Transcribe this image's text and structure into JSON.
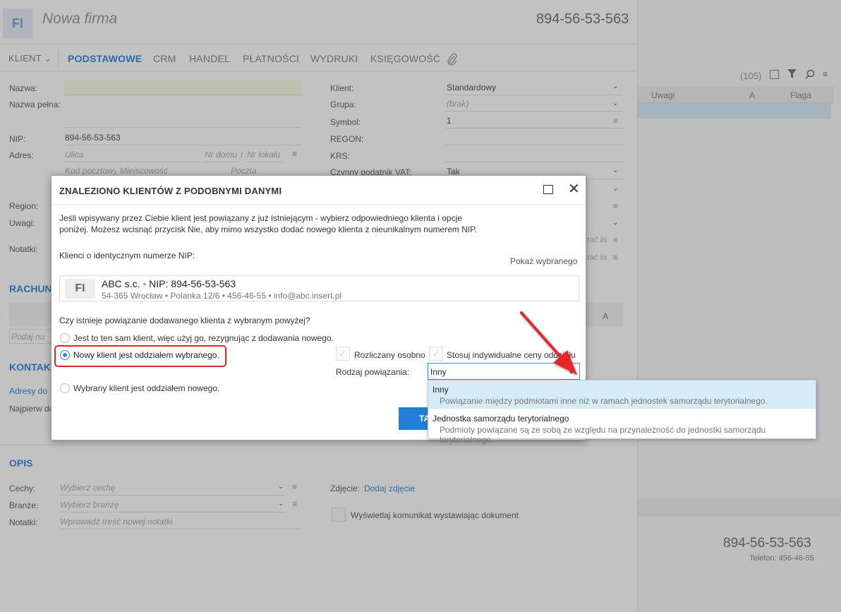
{
  "header": {
    "avatar": "FI",
    "title": "Nowa firma",
    "nip": "894-56-53-563"
  },
  "tabs": [
    {
      "label": "KLIENT",
      "active": false
    },
    {
      "label": "PODSTAWOWE",
      "active": true
    },
    {
      "label": "CRM",
      "active": false
    },
    {
      "label": "HANDEL",
      "active": false
    },
    {
      "label": "PŁATNOŚCI",
      "active": false
    },
    {
      "label": "WYDRUKI",
      "active": false
    },
    {
      "label": "KSIĘGOWOŚĆ",
      "active": false
    }
  ],
  "form_left": {
    "nazwa_label": "Nazwa:",
    "nazwa_pelna_label": "Nazwa pełna:",
    "nip_label": "NIP:",
    "nip_value": "894-56-53-563",
    "adres_label": "Adres:",
    "ulica_ph": "Ulica",
    "nr_domu_ph": "Nr domu",
    "nr_lokalu_ph": "Nr lokalu",
    "kod_ph": "Kod pocztowy",
    "miejscowosc_ph": "Miejscowość",
    "poczta_ph": "Poczta",
    "region_label": "Region:",
    "uwagi_label": "Uwagi:",
    "notatki_label": "Notatki:",
    "rachunki_section": "RACHUN",
    "podaj_ph": "Podaj nu",
    "kontakty_section": "KONTAK",
    "adresy_link": "Adresy do",
    "najpierw": "Najpierw do"
  },
  "form_right": {
    "klient_label": "Klient:",
    "klient_value": "Standardowy",
    "grupa_label": "Grupa:",
    "grupa_value": "(brak)",
    "symbol_label": "Symbol:",
    "symbol_value": "1",
    "regon_label": "REGON:",
    "krs_label": "KRS:",
    "vat_label": "Czynny podatnik VAT:",
    "vat_value": "Tak",
    "wybierz_suffix": "rać lis",
    "col_a": "A"
  },
  "right_panel": {
    "count": "(105)",
    "col_uwagi": "Uwagi",
    "col_a": "A",
    "col_flaga": "Flaga",
    "summary_nip": "894-56-53-563",
    "summary_tel": "Telefon: 456-46-55"
  },
  "opis": {
    "section": "OPIS",
    "cechy_label": "Cechy:",
    "cechy_ph": "Wybierz cechę",
    "branze_label": "Branże:",
    "branze_ph": "Wybierz branżę",
    "notatki_label": "Notatki:",
    "notatki_ph": "Wprowadź treść nowej notatki",
    "zdjecie_label": "Zdjęcie:",
    "zdjecie_link": "Dodaj zdjęcie",
    "komunikat_label": "Wyświetlaj komunikat wystawiając dokument"
  },
  "dialog": {
    "title": "ZNALEZIONO KLIENTÓW Z PODOBNYMI DANYMI",
    "message_line1": "Jeśli wpisywany przez Ciebie klient jest powiązany z już istniejącym - wybierz odpowiedniego klienta i opcje",
    "message_line2": "poniżej. Możesz wcisnąć przycisk Nie, aby mimo wszystko dodać nowego klienta z nieunikalnym numerem NIP.",
    "same_nip_label": "Klienci o identycznym numerze NIP:",
    "show_selected": "Pokaż wybranego",
    "client": {
      "avatar": "FI",
      "name": "ABC s.c.",
      "sep": "•",
      "nip": "NIP: 894-56-53-563",
      "address_line": "54-365 Wrocław • Polanka  12/6  • 456-46-55 • info@abc.insert.pl"
    },
    "question": "Czy istnieje powiązanie dodawanego klienta z wybranym powyżej?",
    "option1": "Jest to ten sam klient, więc użyj go, rezygnując z dodawania nowego.",
    "option2": "Nowy klient jest oddziałem wybranego.",
    "option3": "Wybrany klient jest oddziałem nowego.",
    "selected_option": 2,
    "check_rozliczany": "Rozliczany osobno",
    "check_ceny": "Stosuj indywidualne ceny oddziału",
    "rodzaj_label": "Rodzaj powiązania:",
    "rodzaj_value": "Inny",
    "ok_button_partial": "TA"
  },
  "dropdown": {
    "items": [
      {
        "title": "Inny",
        "desc": "Powiązanie między podmiotami inne niż w ramach jednostek samorządu terytorialnego.",
        "selected": true
      },
      {
        "title": "Jednostka samorządu terytorialnego",
        "desc": "Podmioty powiązane są ze sobą ze względu na przynależność do jednostki samorządu terytorialnego.",
        "selected": false
      }
    ]
  },
  "colors": {
    "accent": "#2f8ee6",
    "highlight": "#d6ebf8",
    "annotation_red": "#e8262c",
    "overlay": "rgba(0,0,0,0.24)"
  }
}
